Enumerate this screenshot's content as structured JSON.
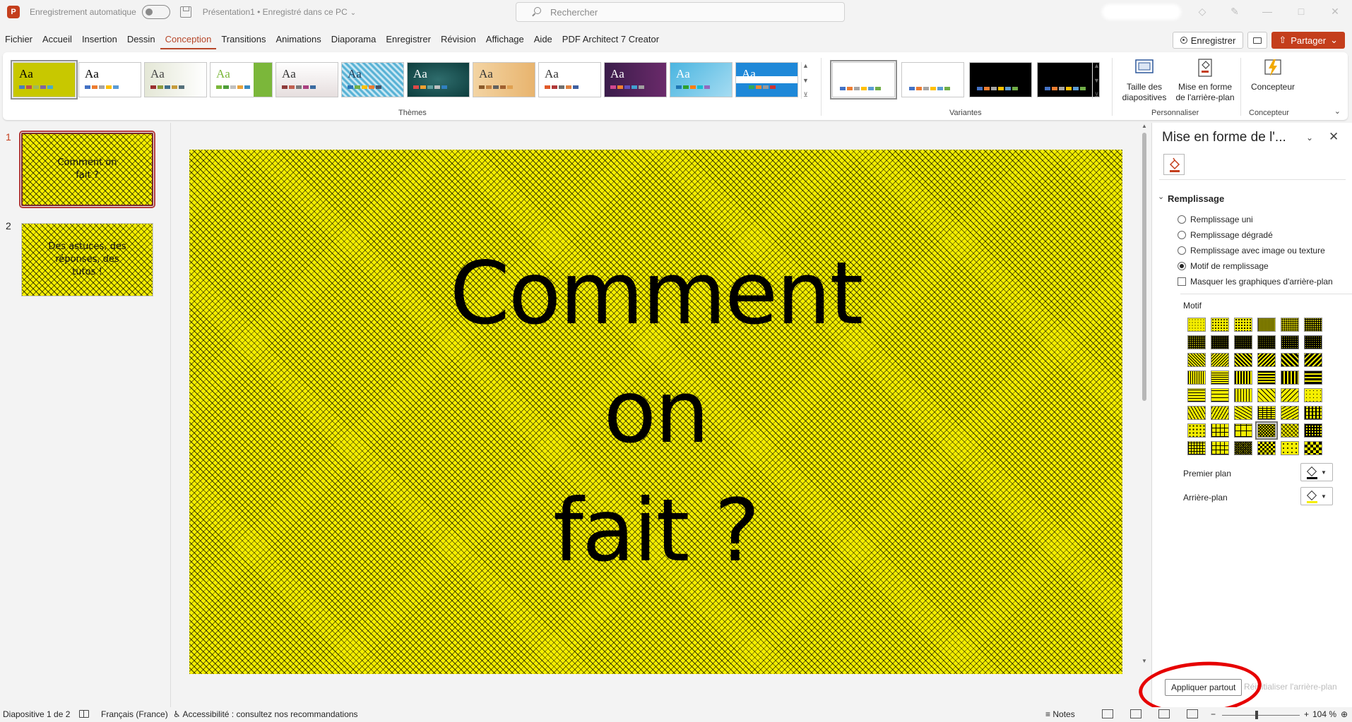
{
  "titlebar": {
    "app_letter": "P",
    "autosave_label": "Enregistrement automatique",
    "doc_title": "Présentation1 • Enregistré dans ce PC",
    "search_placeholder": "Rechercher"
  },
  "menu": {
    "items": [
      "Fichier",
      "Accueil",
      "Insertion",
      "Dessin",
      "Conception",
      "Transitions",
      "Animations",
      "Diaporama",
      "Enregistrer",
      "Révision",
      "Affichage",
      "Aide",
      "PDF Architect 7 Creator"
    ],
    "active_index": 4,
    "record_label": "Enregistrer",
    "share_label": "Partager"
  },
  "ribbon": {
    "themes_label": "Thèmes",
    "variants_label": "Variantes",
    "personnaliser_label": "Personnaliser",
    "concepteur_group_label": "Concepteur",
    "theme_aa": "Aa",
    "size_btn": "Taille des diapositives",
    "bg_btn": "Mise en forme de l'arrière-plan",
    "designer_btn": "Concepteur"
  },
  "slides": [
    {
      "number": "1",
      "text_line1": "Comment on",
      "text_line2": "fait ?"
    },
    {
      "number": "2",
      "text_line1": "Des astuces, des",
      "text_line2": "réponses, des",
      "text_line3": "tutos !"
    }
  ],
  "main_slide": {
    "title_line1": "Comment on",
    "title_line2": "fait ?"
  },
  "format_panel": {
    "title": "Mise en forme de l'...",
    "section": "Remplissage",
    "options": [
      "Remplissage uni",
      "Remplissage dégradé",
      "Remplissage avec image ou texture",
      "Motif de remplissage"
    ],
    "selected_option": "Motif de remplissage",
    "hide_bg_label": "Masquer les graphiques d'arrière-plan",
    "motif_label": "Motif",
    "foreground_label": "Premier plan",
    "background_label": "Arrière-plan",
    "foreground_color": "#000000",
    "background_color": "#f5ee00",
    "apply_all": "Appliquer partout",
    "reset_bg": "Réinitialiser l'arrière-plan"
  },
  "statusbar": {
    "slide_info": "Diapositive 1 de 2",
    "language": "Français (France)",
    "accessibility": "Accessibilité : consultez nos recommandations",
    "notes": "Notes",
    "zoom": "104 %"
  }
}
